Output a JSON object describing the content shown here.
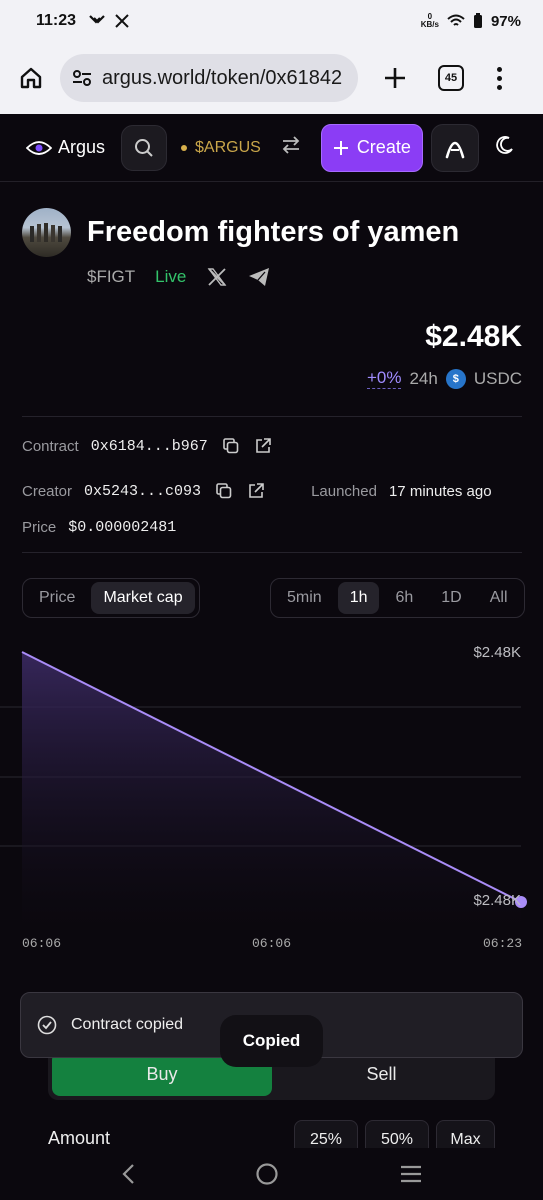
{
  "status_bar": {
    "time": "11:23",
    "net_speed": "0",
    "net_unit": "KB/s",
    "battery": "97%"
  },
  "browser": {
    "url": "argus.world/token/0x61842",
    "tab_count": "45"
  },
  "header": {
    "brand": "Argus",
    "token_ticker": "$ARGUS",
    "create_label": "Create"
  },
  "token": {
    "name": "Freedom fighters of yamen",
    "ticker": "$FIGT",
    "status": "Live",
    "market_cap": "$2.48K",
    "change": "+0%",
    "period": "24h",
    "quote": "USDC"
  },
  "info": {
    "contract_label": "Contract",
    "contract_value": "0x6184...b967",
    "creator_label": "Creator",
    "creator_value": "0x5243...c093",
    "launched_label": "Launched",
    "launched_value": "17 minutes ago",
    "price_label": "Price",
    "price_value": "$0.000002481"
  },
  "chart_toggles": {
    "metric": [
      "Price",
      "Market cap"
    ],
    "metric_active": "Market cap",
    "intervals": [
      "5min",
      "1h",
      "6h",
      "1D",
      "All"
    ],
    "interval_active": "1h"
  },
  "chart_data": {
    "type": "area",
    "x": [
      "06:06",
      "06:23"
    ],
    "x_ticks": [
      "06:06",
      "06:06",
      "06:23"
    ],
    "y_ticks": [
      "$2.48K",
      "$2.48K"
    ],
    "series": [
      {
        "values": [
          1,
          0
        ]
      }
    ],
    "color": "#a98cf7"
  },
  "trade": {
    "buy_label": "Buy",
    "sell_label": "Sell",
    "amount_label": "Amount",
    "pct_buttons": [
      "25%",
      "50%",
      "Max"
    ]
  },
  "toast": {
    "message": "Contract copied",
    "tooltip": "Copied"
  }
}
